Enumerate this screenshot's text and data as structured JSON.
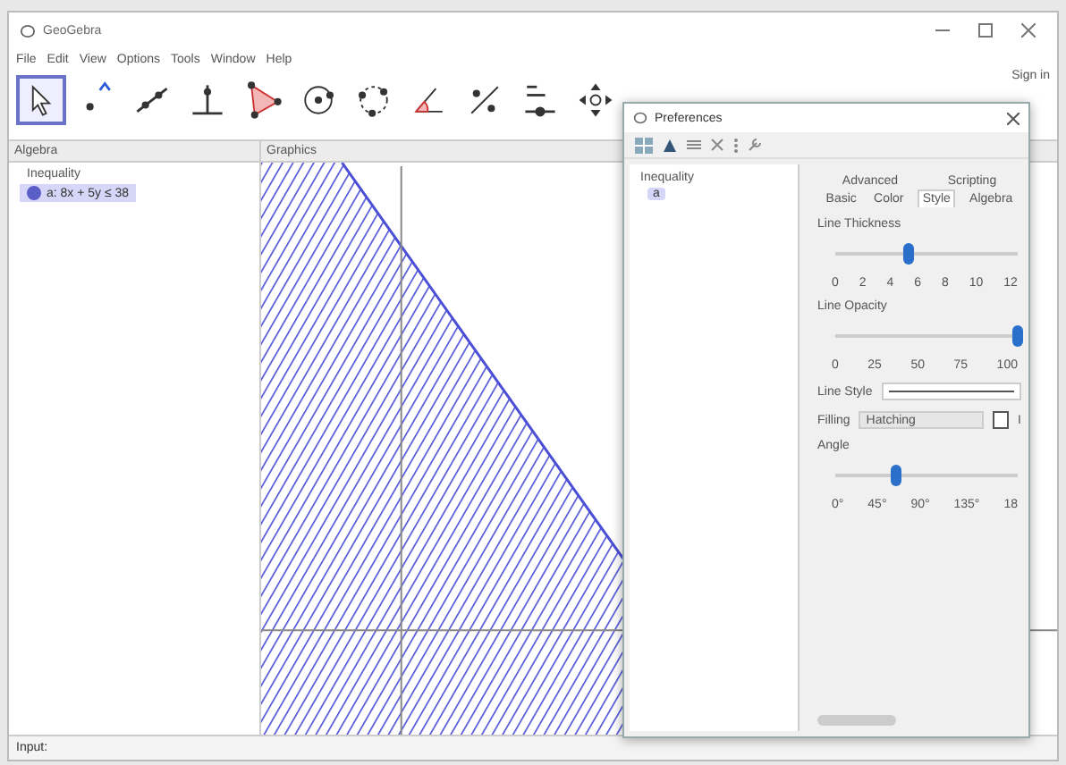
{
  "window": {
    "title": "GeoGebra"
  },
  "menu": [
    "File",
    "Edit",
    "View",
    "Options",
    "Tools",
    "Window",
    "Help"
  ],
  "sign_in": "Sign in",
  "toolbar": [
    {
      "kind": "move",
      "selected": true
    },
    {
      "kind": "point",
      "selected": false
    },
    {
      "kind": "line",
      "selected": false
    },
    {
      "kind": "perpendicular",
      "selected": false
    },
    {
      "kind": "polygon",
      "selected": false
    },
    {
      "kind": "circle",
      "selected": false
    },
    {
      "kind": "circle3",
      "selected": false
    },
    {
      "kind": "angle",
      "selected": false
    },
    {
      "kind": "reflect",
      "selected": false
    },
    {
      "kind": "slider",
      "selected": false
    },
    {
      "kind": "pan",
      "selected": false
    }
  ],
  "algebra": {
    "title": "Algebra",
    "groups": [
      {
        "label": "Inequality",
        "items": [
          {
            "text": "a: 8x + 5y ≤ 38",
            "visible": true,
            "selected": true
          }
        ]
      }
    ]
  },
  "graphics": {
    "title": "Graphics"
  },
  "input": {
    "label": "Input:"
  },
  "preferences": {
    "title": "Preferences",
    "tree": [
      {
        "label": "Inequality",
        "children": [
          {
            "label": "a",
            "selected": true
          }
        ]
      }
    ],
    "tabs": [
      [
        {
          "label": "Advanced",
          "selected": false
        },
        {
          "label": "Scripting",
          "selected": false
        }
      ],
      [
        {
          "label": "Basic",
          "selected": false
        },
        {
          "label": "Color",
          "selected": false
        },
        {
          "label": "Style",
          "selected": true
        },
        {
          "label": "Algebra",
          "selected": false
        }
      ]
    ],
    "sliders": [
      {
        "label": "Line Thickness",
        "level": 0.4,
        "ticks": [
          "0",
          "2",
          "4",
          "6",
          "8",
          "10",
          "12"
        ]
      },
      {
        "label": "Line Opacity",
        "level": 1,
        "ticks": [
          "0",
          "25",
          "50",
          "75",
          "100"
        ]
      }
    ],
    "line_style": {
      "label": "Line Style"
    },
    "filling": {
      "label": "Filling",
      "value": "Hatching",
      "checked": false,
      "check_label": "I"
    },
    "angle": {
      "label": "Angle",
      "level": 0.33,
      "ticks": [
        "0°",
        "45°",
        "90°",
        "135°",
        "18"
      ]
    }
  }
}
